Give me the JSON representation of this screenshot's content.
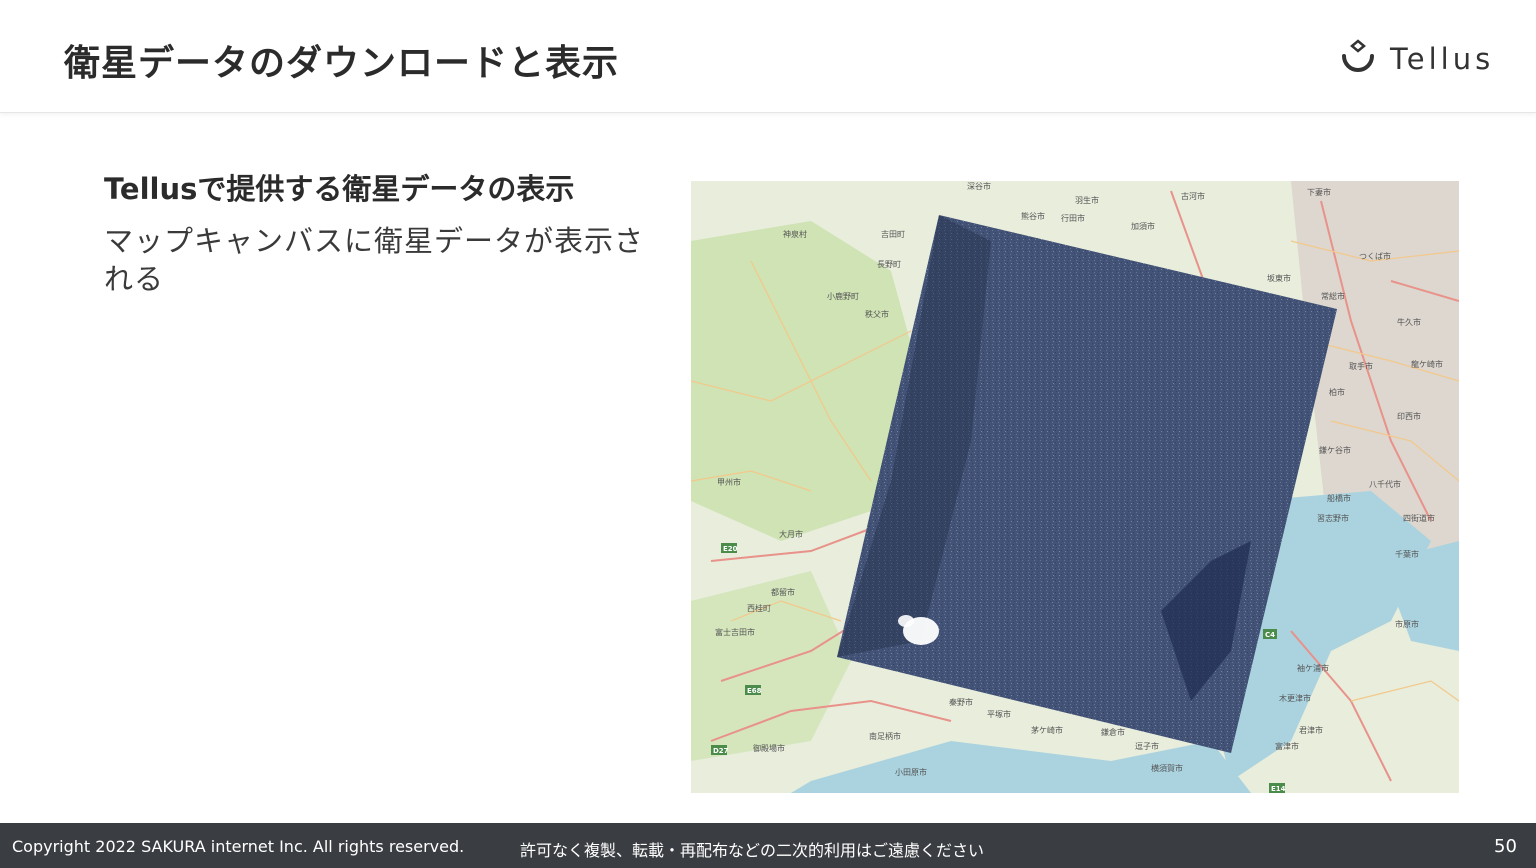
{
  "header": {
    "title": "衛星データのダウンロードと表示",
    "logo_text": "Tellus"
  },
  "content": {
    "subheading": "Tellusで提供する衛星データの表示",
    "body": "マップキャンバスに衛星データが表示される"
  },
  "map": {
    "labels": [
      "深谷市",
      "羽生市",
      "古河市",
      "下妻市",
      "熊谷市",
      "行田市",
      "加須市",
      "神泉村",
      "長野町",
      "吉田町",
      "小鹿野町",
      "秩父市",
      "つくば市",
      "坂東市",
      "常総市",
      "牛久市",
      "取手市",
      "龍ケ崎市",
      "印西市",
      "柏市",
      "鎌ケ谷市",
      "八千代市",
      "船橋市",
      "習志野市",
      "四街道市",
      "千葉市",
      "甲州市",
      "大月市",
      "都留市",
      "西桂町",
      "富士吉田市",
      "秦野市",
      "平塚市",
      "茅ケ崎市",
      "鎌倉市",
      "逗子市",
      "横須賀市",
      "南足柄市",
      "小田原市",
      "御殿場市",
      "木更津市",
      "袖ケ浦市",
      "君津市",
      "富津市",
      "市原市",
      "E20",
      "E68",
      "D27",
      "C4",
      "E14"
    ],
    "colors": {
      "land": "#e8eddc",
      "forest": "#cfe3b4",
      "urban": "#ddd7cf",
      "water": "#aad3df",
      "major_road": "#e8928a",
      "minor_road": "#f3c88a",
      "satellite": "#4a5a7e"
    }
  },
  "footer": {
    "copyright": "Copyright 2022 SAKURA internet Inc. All rights reserved.",
    "notice": "許可なく複製、転載・再配布などの二次的利用はご遠慮ください",
    "page_number": "50"
  }
}
